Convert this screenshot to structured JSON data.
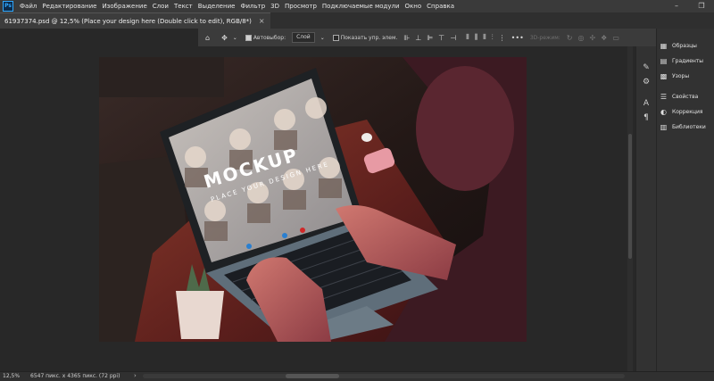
{
  "menu": {
    "logo": "Ps",
    "items": [
      "Файл",
      "Редактирование",
      "Изображение",
      "Слои",
      "Текст",
      "Выделение",
      "Фильтр",
      "3D",
      "Просмотр",
      "Подключаемые модули",
      "Окно",
      "Справка"
    ]
  },
  "tab": {
    "title": "61937374.psd @ 12,5% (Place your design here (Double click to edit), RGB/8*)",
    "close": "×"
  },
  "options": {
    "autoselect_label": "Автовыбор:",
    "layer_select": "Слой",
    "show_transform_label": "Показать упр. элем.",
    "mode_3d_label": "3D-режим:"
  },
  "panels": {
    "items": [
      {
        "label": "Образцы",
        "icon": "swatches-icon"
      },
      {
        "label": "Градиенты",
        "icon": "gradients-icon"
      },
      {
        "label": "Узоры",
        "icon": "patterns-icon"
      },
      {
        "label": "Свойства",
        "icon": "properties-icon"
      },
      {
        "label": "Коррекция",
        "icon": "adjustments-icon"
      },
      {
        "label": "Библиотеки",
        "icon": "libraries-icon"
      }
    ]
  },
  "mockup": {
    "title": "MOCKUP",
    "subtitle": "PLACE YOUR DESIGN HERE"
  },
  "status": {
    "zoom": "12,5%",
    "info": "6547 пикс. x 4365 пикс. (72 ppi)",
    "arrow": "›"
  },
  "colors": {
    "accent": "#31a8ff",
    "ui_bg": "#282828",
    "menu_bg": "#3a3a3a"
  }
}
